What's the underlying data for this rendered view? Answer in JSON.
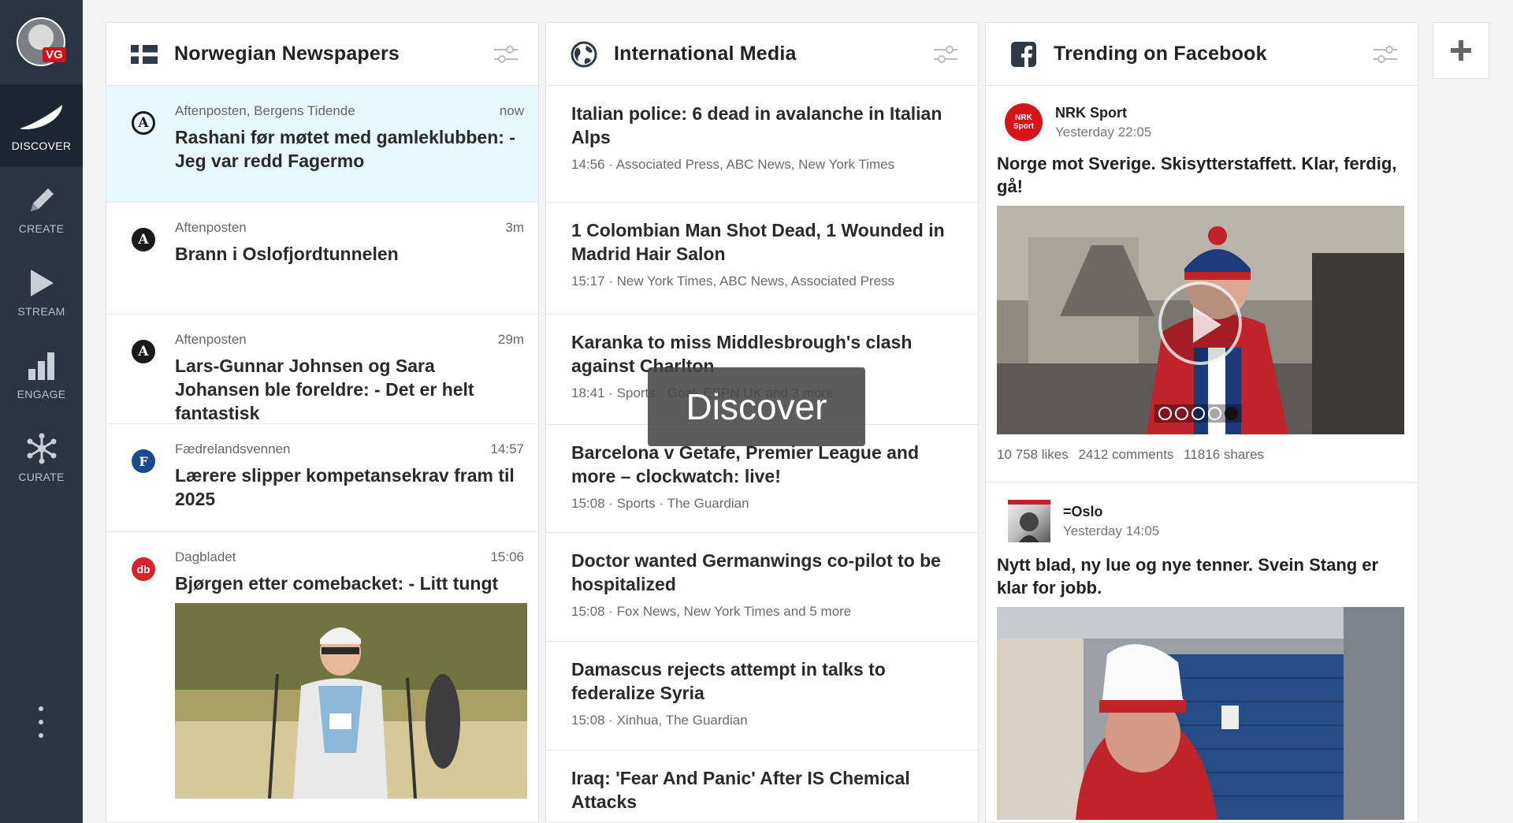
{
  "sidebar": {
    "avatar_badge": "VG",
    "items": [
      {
        "label": "DISCOVER",
        "icon": "discover-swoosh-icon",
        "active": true
      },
      {
        "label": "CREATE",
        "icon": "pencil-icon",
        "active": false
      },
      {
        "label": "STREAM",
        "icon": "play-icon",
        "active": false
      },
      {
        "label": "ENGAGE",
        "icon": "bar-chart-icon",
        "active": false
      },
      {
        "label": "CURATE",
        "icon": "network-icon",
        "active": false
      }
    ],
    "more_icon": "vertical-dots-icon"
  },
  "columns": {
    "norwegian": {
      "title": "Norwegian Newspapers",
      "icon": "norway-flag-icon",
      "items": [
        {
          "source": "Aftenposten, Bergens Tidende",
          "time": "now",
          "headline": "Rashani før møtet med gamleklubben: - Jeg var redd Fagermo",
          "logo": "A",
          "logo_color": "#1a1a1a"
        },
        {
          "source": "Aftenposten",
          "time": "3m",
          "headline": "Brann i Oslofjordtunnelen",
          "logo": "A",
          "logo_color": "#1a1a1a"
        },
        {
          "source": "Aftenposten",
          "time": "29m",
          "headline": "Lars-Gunnar Johnsen og Sara Johansen ble foreldre: - Det er helt fantastisk",
          "logo": "A",
          "logo_color": "#1a1a1a"
        },
        {
          "source": "Fædrelandsvennen",
          "time": "14:57",
          "headline": "Lærere slipper kompetansekrav fram til 2025",
          "logo": "F",
          "logo_color": "#1b4a8c"
        },
        {
          "source": "Dagbladet",
          "time": "15:06",
          "headline": "Bjørgen etter comebacket: - Litt tungt",
          "logo": "db",
          "logo_color": "#d8232a"
        }
      ]
    },
    "international": {
      "title": "International Media",
      "icon": "globe-icon",
      "items": [
        {
          "headline": "Italian police: 6 dead in avalanche in Italian Alps",
          "meta": "14:56 · Associated Press, ABC News, New York Times"
        },
        {
          "headline": "1 Colombian Man Shot Dead, 1 Wounded in Madrid Hair Salon",
          "meta": "15:17 · New York Times, ABC News, Associated Press"
        },
        {
          "headline": "Karanka to miss Middlesbrough's clash against Charlton",
          "meta": "18:41 · Sports · Goal, ESPN UK and 3 more"
        },
        {
          "headline": "Barcelona v Getafe, Premier League and more – clockwatch: live!",
          "meta": "15:08 · Sports · The Guardian"
        },
        {
          "headline": "Doctor wanted Germanwings co-pilot to be hospitalized",
          "meta": "15:08 · Fox News, New York Times and 5 more"
        },
        {
          "headline": "Damascus rejects attempt in talks to federalize Syria",
          "meta": "15:08 · Xinhua, The Guardian"
        },
        {
          "headline": "Iraq: 'Fear And Panic' After IS Chemical Attacks",
          "meta": ""
        }
      ]
    },
    "facebook": {
      "title": "Trending on Facebook",
      "icon": "facebook-icon",
      "posts": [
        {
          "name": "NRK Sport",
          "time": "Yesterday 22:05",
          "text": "Norge mot Sverige. Skisytterstaffett. Klar, ferdig, gå!",
          "likes": "10 758 likes",
          "comments": "2412 comments",
          "shares": "11816 shares",
          "avatar_text": "NRK Sport"
        },
        {
          "name": "=Oslo",
          "time": "Yesterday 14:05",
          "text": "Nytt blad, ny lue og nye tenner. Svein Stang er klar for jobb."
        }
      ]
    }
  },
  "add_column_icon": "plus-icon",
  "tooltip": "Discover",
  "colors": {
    "sidebar": "#2b3440",
    "sidebar_active": "#1d2530",
    "highlight": "#e7f8fd"
  }
}
